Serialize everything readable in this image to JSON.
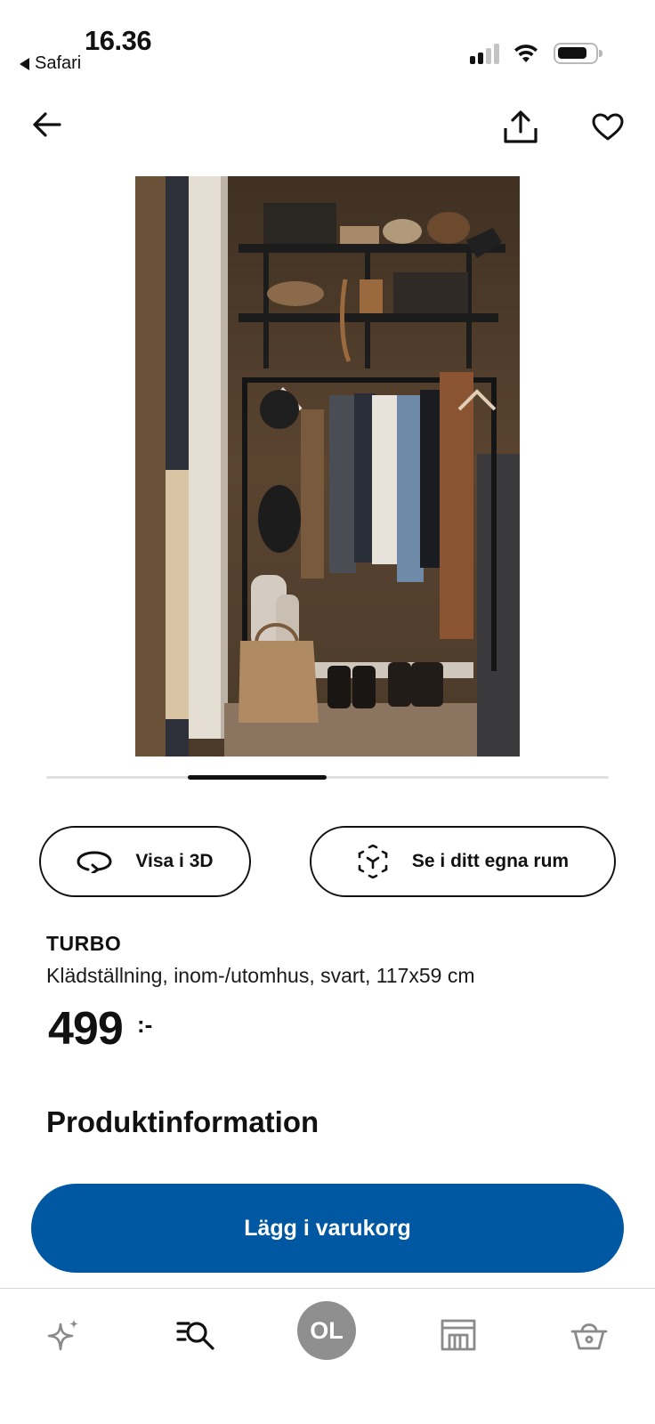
{
  "status_bar": {
    "time": "16.36",
    "back_app": "Safari"
  },
  "top_nav": {
    "icons": [
      "arrow-left-icon",
      "share-icon",
      "heart-icon"
    ]
  },
  "carousel": {
    "active_index": 1,
    "fraction_position": 0.25
  },
  "actions": {
    "view_3d": "Visa i 3D",
    "view_in_room": "Se i ditt egna rum"
  },
  "product": {
    "name": "TURBO",
    "description": "Klädställning, inom-/utomhus, svart, 117x59 cm",
    "price": "499",
    "price_suffix": ":-"
  },
  "sections": {
    "product_info_title": "Produktinformation"
  },
  "cart": {
    "add_label": "Lägg i varukorg"
  },
  "tabbar": {
    "profile_initials": "OL",
    "icons": [
      "sparkle-icon",
      "search-list-icon",
      "profile-avatar",
      "store-icon",
      "basket-icon"
    ]
  },
  "colors": {
    "primary_blue": "#0058a3",
    "text": "#111111",
    "avatar_gray": "#8f8f8f"
  }
}
